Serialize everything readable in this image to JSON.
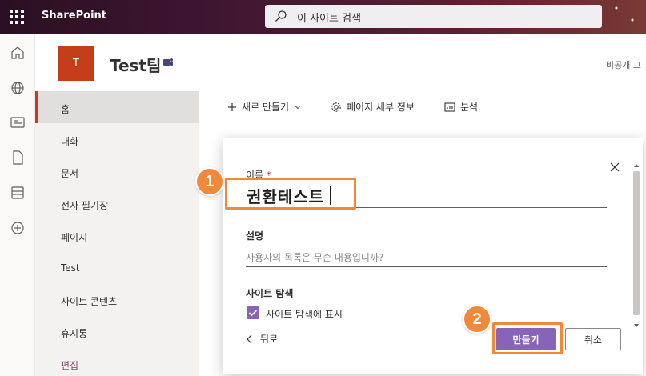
{
  "suite": {
    "brand": "SharePoint",
    "search_placeholder": "이 사이트 검색"
  },
  "site": {
    "logo_letter": "T",
    "title": "Test팀",
    "privacy": "비공개 그"
  },
  "leftnav": {
    "items": [
      {
        "label": "홈",
        "active": true
      },
      {
        "label": "대화"
      },
      {
        "label": "문서"
      },
      {
        "label": "전자 필기장"
      },
      {
        "label": "페이지"
      },
      {
        "label": "Test"
      },
      {
        "label": "사이트 콘텐츠"
      },
      {
        "label": "휴지통"
      },
      {
        "label": "편집"
      }
    ]
  },
  "commandbar": {
    "new_label": "새로 만들기",
    "page_details_label": "페이지 세부 정보",
    "analytics_label": "분석"
  },
  "dialog": {
    "name_label": "이름",
    "required_mark": "*",
    "name_value": "권환테스트",
    "description_label": "설명",
    "description_placeholder": "사용자의 목록은 무슨 내용입니까?",
    "navigation_label": "사이트 탐색",
    "show_in_nav_label": "사이트 탐색에 표시",
    "show_in_nav_checked": true,
    "back_label": "뒤로",
    "create_label": "만들기",
    "cancel_label": "취소"
  },
  "annotations": {
    "step1": "1",
    "step2": "2",
    "color": "#f0893a"
  },
  "colors": {
    "accent": "#8764b8",
    "site_logo": "#c43e1c"
  }
}
